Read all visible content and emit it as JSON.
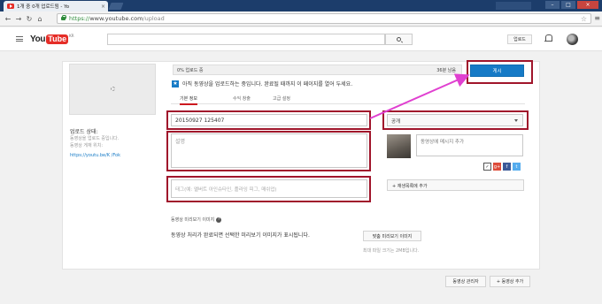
{
  "browser": {
    "tab_title": "1개 중 0개 업로드됨 - Yo",
    "tab_close": "×",
    "url_https": "https://",
    "url_host": "www.youtube.com",
    "url_path": "/upload",
    "win_min": "–",
    "win_max": "□",
    "win_close": "×"
  },
  "header": {
    "logo_you": "You",
    "logo_tube": "Tube",
    "region": "KR",
    "upload_label": "업로드"
  },
  "upload": {
    "status_title": "업로드 상태:",
    "status_line1": "동영상을 업로드 중입니다.",
    "status_line2": "동영상 게재 위치:",
    "status_link": "https://youtu.be/K          /Fok",
    "progress_label": "0% 업로드 중",
    "progress_percent": 0,
    "progress_remaining": "36분 남음",
    "notice": "아직 동영상을 업로드하는 중입니다. 완료될 때까지 이 페이지를 열어 두세요.",
    "publish_label": "게시"
  },
  "tabs": [
    {
      "label": "기본 정보",
      "active": true
    },
    {
      "label": "수익 창출",
      "active": false
    },
    {
      "label": "고급 설정",
      "active": false
    }
  ],
  "form": {
    "title_value": "20150927 125407",
    "description_placeholder": "설명",
    "tags_placeholder": "태그(예: 앨버트 아인슈타인, 플라잉 피그, 매쉬업)",
    "privacy_value": "공개",
    "share_placeholder": "동영상에 메시지 추가",
    "playlist_label": "+ 재생목록에 추가"
  },
  "thumbnails": {
    "title": "동영상 미리보기 이미지",
    "help": "?",
    "text": "동영상 처리가 완료되면 선택한 미리보기 이미지가 표시됩니다.",
    "custom_label": "맞춤 미리보기 이미지",
    "max_size": "최대 파일 크기는 2MB입니다."
  },
  "footer": {
    "manager_label": "동영상 관리자",
    "add_more_label": "+ 동영상 추가"
  },
  "icons": {
    "social_check": "✓",
    "gplus": "g+",
    "facebook": "f",
    "twitter": "t"
  },
  "colors": {
    "brand_red": "#e52d27",
    "publish_blue": "#167ac6",
    "annotation_red": "#a0152b",
    "arrow_magenta": "#e040d0"
  }
}
